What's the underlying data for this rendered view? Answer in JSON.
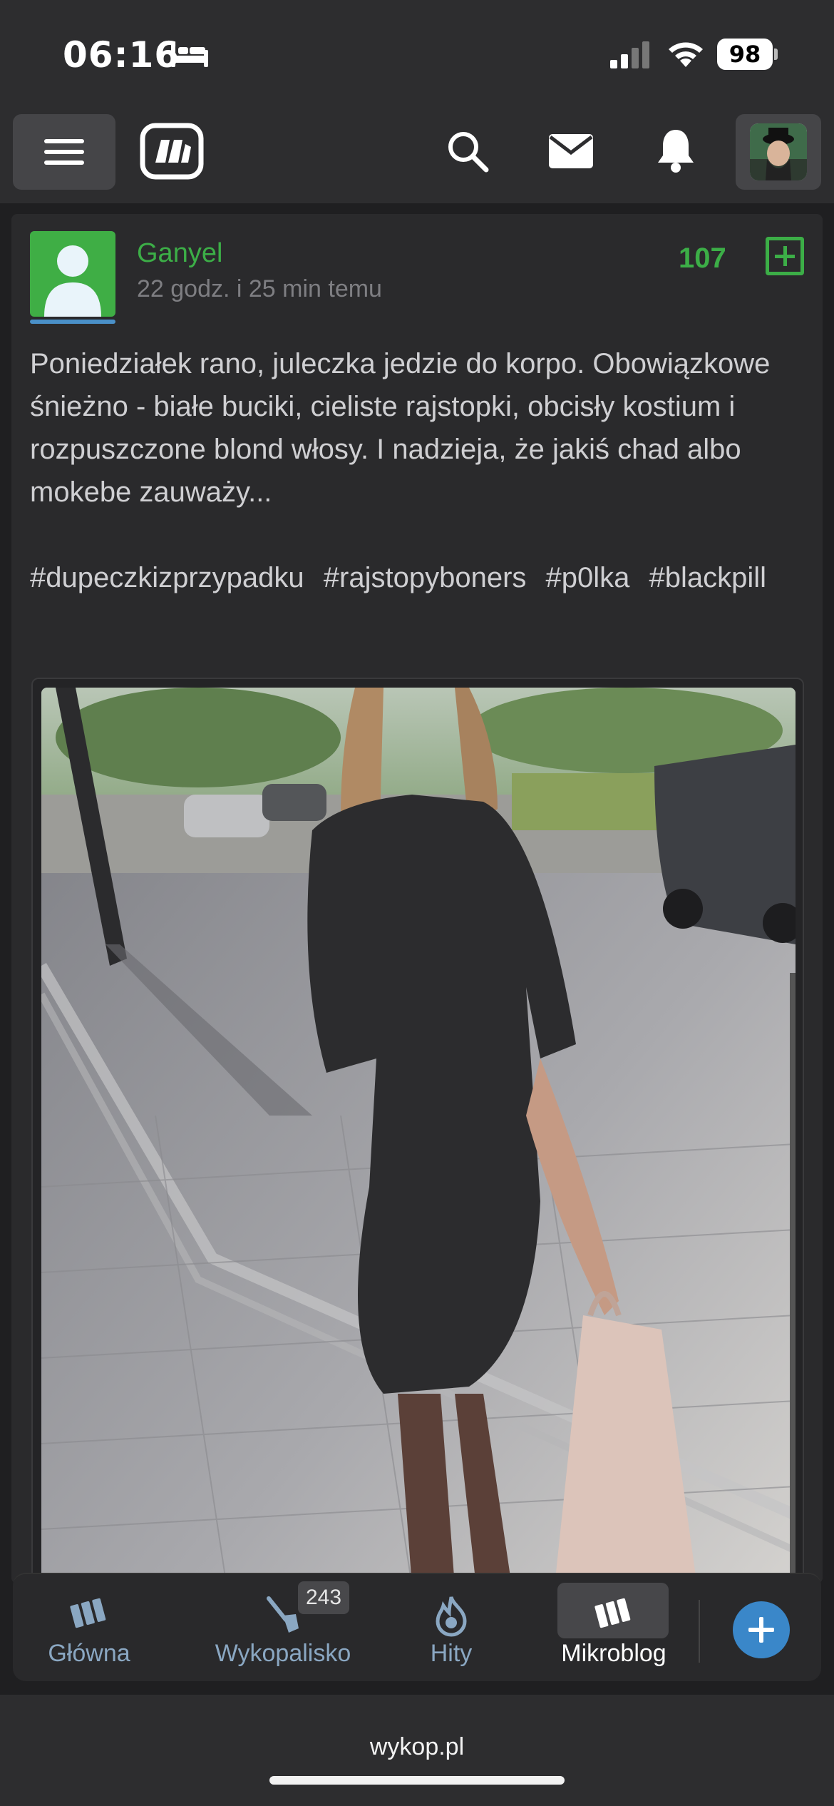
{
  "status_bar": {
    "time": "06:16",
    "battery": "98",
    "icons": [
      "bed-icon",
      "signal-icon",
      "wifi-icon",
      "battery-icon"
    ]
  },
  "header": {
    "icons": [
      "menu-icon",
      "wykop-logo-icon",
      "search-icon",
      "mail-icon",
      "bell-icon",
      "user-avatar"
    ]
  },
  "post": {
    "author": "Ganyel",
    "time": "22 godz. i 25 min temu",
    "votes": "107",
    "text": "Poniedziałek rano, juleczka jedzie do korpo. Obowiązkowe śnieżno - białe buciki, cieliste rajstopki, obcisły kostium i rozpuszczone blond włosy. I nadzieja, że jakiś chad albo mokebe zauważy...",
    "tags": [
      "#dupeczkizprzypadku",
      "#rajstopyboners",
      "#p0lka",
      "#blackpill"
    ],
    "author_color": "#3cae47"
  },
  "bottom_nav": {
    "items": [
      {
        "label": "Główna",
        "icon": "home-logo-icon"
      },
      {
        "label": "Wykopalisko",
        "icon": "shovel-icon",
        "badge": "243"
      },
      {
        "label": "Hity",
        "icon": "flame-icon"
      },
      {
        "label": "Mikroblog",
        "icon": "mikroblog-icon",
        "active": true
      }
    ],
    "add_icon": "plus-icon",
    "accent": "#3a87c9"
  },
  "browser": {
    "url": "wykop.pl"
  }
}
